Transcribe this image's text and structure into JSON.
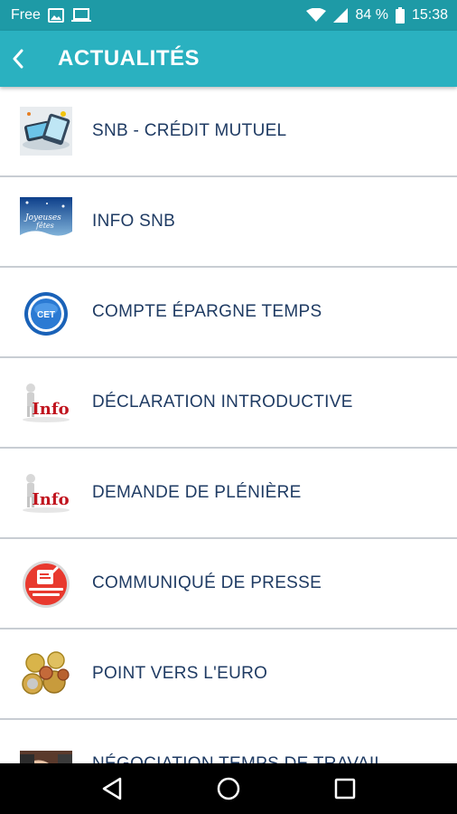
{
  "status_bar": {
    "carrier": "Free",
    "battery": "84 %",
    "time": "15:38"
  },
  "app_bar": {
    "title": "ACTUALITÉS"
  },
  "items": [
    {
      "label": "SNB - CRÉDIT MUTUEL",
      "icon": "phone-banking-icon"
    },
    {
      "label": "INFO SNB",
      "icon": "winter-greeting-icon"
    },
    {
      "label": "COMPTE ÉPARGNE TEMPS",
      "icon": "cet-badge-icon",
      "badge_text": "CET"
    },
    {
      "label": "DÉCLARATION INTRODUCTIVE",
      "icon": "info-figure-icon",
      "badge_text": "Info"
    },
    {
      "label": "DEMANDE DE PLÉNIÈRE",
      "icon": "info-figure-icon",
      "badge_text": "Info"
    },
    {
      "label": "COMMUNIQUÉ DE PRESSE",
      "icon": "press-release-icon"
    },
    {
      "label": "POINT VERS L'EURO",
      "icon": "euro-coins-icon"
    },
    {
      "label": "NÉGOCIATION TEMPS DE TRAVAIL",
      "icon": "handshake-icon"
    }
  ],
  "colors": {
    "status_bar": "#1e9aa6",
    "app_bar": "#2ab1c0",
    "label_text": "#1f3b63",
    "divider": "#c8cdd3"
  }
}
